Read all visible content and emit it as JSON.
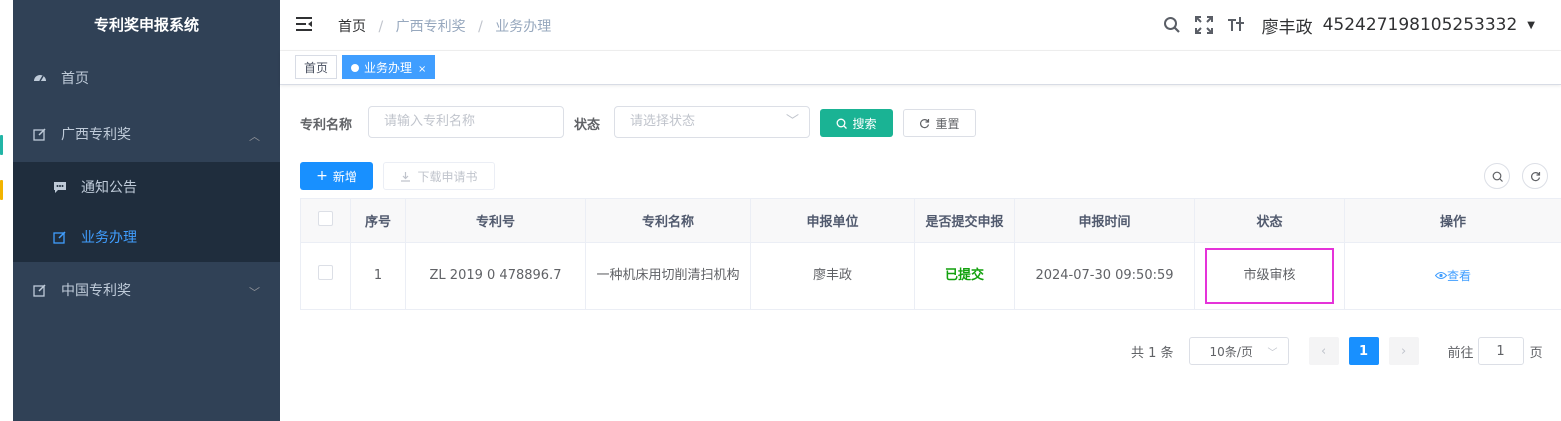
{
  "app": {
    "title": "专利奖申报系统"
  },
  "sidebar": {
    "items": [
      {
        "label": "首页",
        "icon": "dashboard-icon"
      },
      {
        "label": "广西专利奖",
        "icon": "edit-icon",
        "expanded": true,
        "children": [
          {
            "label": "通知公告",
            "icon": "message-icon"
          },
          {
            "label": "业务办理",
            "icon": "edit-icon",
            "active": true
          }
        ]
      },
      {
        "label": "中国专利奖",
        "icon": "edit-icon",
        "expanded": false
      }
    ]
  },
  "navbar": {
    "breadcrumb": [
      "首页",
      "广西专利奖",
      "业务办理"
    ],
    "user_name": "廖丰政",
    "user_id": "452427198105253332"
  },
  "tags": [
    {
      "label": "首页"
    },
    {
      "label": "业务办理",
      "active": true
    }
  ],
  "search": {
    "patent_name_label": "专利名称",
    "patent_name_placeholder": "请输入专利名称",
    "status_label": "状态",
    "status_placeholder": "请选择状态",
    "search_button": "搜索",
    "reset_button": "重置"
  },
  "toolbar": {
    "add_button": "新增",
    "download_button": "下载申请书"
  },
  "table": {
    "columns": [
      "",
      "序号",
      "专利号",
      "专利名称",
      "申报单位",
      "是否提交申报",
      "申报时间",
      "状态",
      "操作"
    ],
    "rows": [
      {
        "index": "1",
        "patent_no": "ZL 2019 0 478896.7",
        "patent_name": "一种机床用切削清扫机构",
        "unit": "廖丰政",
        "submitted": "已提交",
        "time": "2024-07-30 09:50:59",
        "status": "市级审核",
        "action": "查看"
      }
    ]
  },
  "pagination": {
    "total": "共 1 条",
    "page_size": "10条/页",
    "current_page": "1",
    "goto_label": "前往",
    "goto_value": "1",
    "page_suffix": "页"
  },
  "colors": {
    "sidebar_bg": "#304156",
    "submenu_bg": "#1f2d3d",
    "primary": "#1890ff",
    "search_button": "#1ab394",
    "status_highlight": "#e533d9",
    "submitted_text": "#13a10e"
  }
}
